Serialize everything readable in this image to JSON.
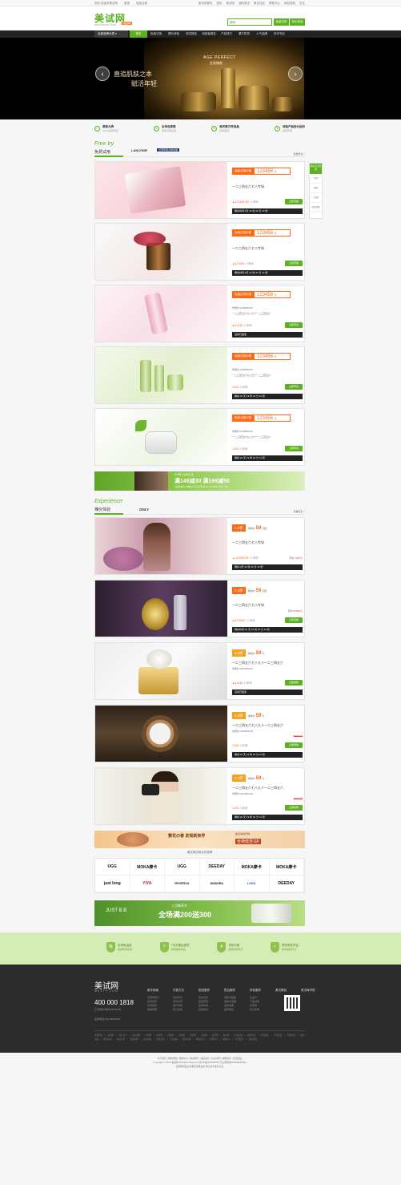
{
  "topbar": {
    "left": [
      "您好,欢迎来美试网",
      "登录",
      "免费注册"
    ],
    "right": [
      "美试网首页",
      "首页",
      "美试网",
      "我的美试",
      "美试社区",
      "帮助中心",
      "网站导航",
      "关注"
    ]
  },
  "header": {
    "logo": "美试网",
    "logo_sub": "WWW.MAXTP.COM",
    "logo_badge": "美试网",
    "search_placeholder": "搜索",
    "btn1": "免费试用",
    "btn2": "特价体验"
  },
  "nav": {
    "category": "全部品牌分类 ▾",
    "items": [
      "首页",
      "免费试用",
      "裸价体验",
      "测试报告",
      "消费者报告",
      "产品排行",
      "看牛机构",
      "人气品牌",
      "好评专区"
    ]
  },
  "banner": {
    "text1": "直追肌肤之本",
    "text2": "赋活年轻",
    "brand": "AGE PERFECT",
    "brand2": "金致臻颜",
    "prev": "‹",
    "next": "›"
  },
  "features": [
    {
      "icon": "✓",
      "title": "原装大牌",
      "sub": "100%品牌保证"
    },
    {
      "icon": "◎",
      "title": "全场包邮费",
      "sub": "免费试用全场"
    },
    {
      "icon": "★",
      "title": "每天数万件商品",
      "sub": "任你挑选"
    },
    {
      "icon": "¥",
      "title": "体验产品低价起折",
      "sub": "品牌优惠"
    }
  ],
  "free": {
    "en": "Free try",
    "cn": "免费试用",
    "brand_logo": "LANCÔME",
    "brand_tag": "兰蔻年度大牌试用",
    "more": "查看更多 >",
    "cards": [
      {
        "tag": "免费试用价格",
        "price": "123456",
        "unit": "件",
        "title": "一二三四五六七八专场",
        "count": "123456789",
        "count_unit": "人申请",
        "apply": "立即查看",
        "time": "剩余时间:0天 21 时 22 分 12 秒"
      },
      {
        "tag": "免费试用价格",
        "price": "123456",
        "unit": "件",
        "title": "一二三四五六七八专场",
        "count": "123456",
        "count_unit": "人申请",
        "apply": "立即查看",
        "time": "剩余时间:0天 21 时 22 分 12 秒"
      },
      {
        "tag": "免费试用价格",
        "price": "123456",
        "unit": "件",
        "meta1": "市场价:¥139999.00",
        "meta2": "一二三四五六七八九十一二三四五六",
        "count": "12345",
        "count_unit": "人申请",
        "apply": "立即申请",
        "time": "活动已结束"
      },
      {
        "tag": "免费试用价格",
        "price": "123456",
        "unit": "件",
        "meta1": "市场价:¥139999.00",
        "meta2": "一二三四五六七八九十一二三四五六",
        "count": "1234",
        "count_unit": "人申请",
        "apply": "立即申请",
        "time": "剩余:01 天 21 时 22 分 12 秒"
      },
      {
        "tag": "免费试用价格",
        "price": "123456",
        "unit": "件",
        "meta1": "市场价:¥139999.00",
        "meta2": "一二三四五六七八九十一二三四五六",
        "count": "1236",
        "count_unit": "人申请",
        "apply": "立即申请",
        "time": "剩余:01 天 21 时 22 分 12 秒"
      }
    ],
    "ad": {
      "brand": "PURELAND 诗",
      "text": "满149减30 满199减50",
      "sub": "天猫商城官方旗舰店 即日起至3月31日 IPHONE 吉价 已售"
    }
  },
  "exp": {
    "en": "Experience",
    "cn": "裸价体验",
    "brand_logo": "ONLY",
    "more": "查看更多 >",
    "cards": [
      {
        "disc": "2.2折",
        "price": "59",
        "unit": "元起",
        "title": "一二三四五六七八专场",
        "count": "123456789",
        "count_unit": "人申请",
        "orig_label": "原价:",
        "orig": "1000元",
        "apply": "立即查看",
        "time": "剩余:0天 21 时 22 分 12 秒"
      },
      {
        "disc": "2.2折",
        "price": "59",
        "unit": "元起",
        "title": "一二三四五六七八专场",
        "count": "1234567",
        "count_unit": "人申请",
        "orig_label": "原价:",
        "orig": "99999元",
        "apply": "立即查看",
        "time": "剩余时间:01 天 21 时 22 分 12 秒"
      },
      {
        "disc": "2.2折",
        "price": "59",
        "unit": "元",
        "title": "一二三四五六七八九十一二三四五六",
        "meta1": "市场价:¥123456.00",
        "count": "12345",
        "count_unit": "人申请",
        "apply": "立即抢购",
        "time": "活动已结束"
      },
      {
        "disc": "2.2折",
        "price": "59",
        "unit": "元",
        "title": "一二三四五六七八九十一二三四五六",
        "meta1": "市场价:¥123456.00",
        "orig": "99999元",
        "count": "1238",
        "count_unit": "人申请",
        "apply": "立即抢购",
        "time": "剩余:01 天 21 时 22 分 12 秒"
      },
      {
        "disc": "2.2折",
        "price": "59",
        "unit": "元",
        "title": "一二三四五六七八九十一二三四五六",
        "meta1": "市场价:¥123456.00",
        "orig": "99999元",
        "count": "1238",
        "count_unit": "人申请",
        "apply": "立即抢购",
        "time": "剩余:01 天 21 时 22 分 12 秒"
      }
    ],
    "ad": {
      "text": "繁花の春 发现新饰界",
      "sub": "全场低至1折",
      "sub2": "甄选新品欢乐购"
    }
  },
  "brands": {
    "title": "美试网目前合作品牌",
    "items": [
      "UGG",
      "MOKA摩卡",
      "UGG",
      "DEEDAY",
      "MOKA摩卡",
      "MOKA摩卡",
      "just long",
      "YIYA",
      "SPORTICA",
      "DIADORA",
      "LOGO",
      "DEEDAY"
    ]
  },
  "bottom_ad": {
    "brand": "JUST B.B",
    "title": "三月畅享节",
    "text": "全场满200送300"
  },
  "service": [
    {
      "icon": "免",
      "title": "全场免运费",
      "sub": "免邮费用全场"
    },
    {
      "icon": "7",
      "title": "7天无理由退货",
      "sub": "如何退换商品"
    },
    {
      "icon": "¥",
      "title": "货到付款",
      "sub": "如何选择支付"
    },
    {
      "icon": "✓",
      "title": "提供有效凭证",
      "sub": "如何提供凭证"
    }
  ],
  "footer": {
    "logo": "美试网",
    "logo_sub": "MAXTP.COM",
    "phone": "400 000 1818",
    "hours": "工作时间:每天9:00-18:00",
    "email": "招商电话:010-66666666",
    "cols": [
      {
        "h": "新手指南",
        "items": [
          "注册新用户",
          "会员登录",
          "找回密码",
          "购物流程"
        ]
      },
      {
        "h": "付款方式",
        "items": [
          "在线支付",
          "货到付款",
          "银行转账",
          "积分兑换"
        ]
      },
      {
        "h": "配送服务",
        "items": [
          "配送方式",
          "配送范围",
          "配送时间",
          "签收验货"
        ]
      },
      {
        "h": "售后服务",
        "items": [
          "退换货政策",
          "退换货流程",
          "退款说明",
          "返修服务"
        ]
      },
      {
        "h": "特色服务",
        "items": [
          "礼品卡",
          "产品试用",
          "优惠券",
          "积分商城"
        ]
      },
      {
        "h": "美试微信",
        "items": [
          "扫一扫",
          "关注我们",
          "",
          ""
        ]
      },
      {
        "h": "美试商学院",
        "items": [
          " ",
          " ",
          " ",
          " "
        ]
      }
    ],
    "links": "友情链接 | 美试网 | 美妆达人 | 化妆品网 | 时尚网 | 美容网 | 护肤网 | 彩妆网 | 香水网 | 美发网 | 美甲网 | 瘦身网 | 时尚女装 | 品牌男装 | 鞋类箱包 | 手表饰品 | 母婴用品 | 家居用品 | 数码家电 | 运动户外 | 食品保健 | 美食团购 | 旅游度假 | 汽车用品 | 图书音像 | 网络游戏 | 手机通讯 | 电脑办公 | 生活服务 | 更多链接"
  },
  "copyright": {
    "line1": "关于我们 | 网站导航 | 帮助中心 | 联系我们 | 诚征英才 | 免责声明 | 诚聘英才 | 意见反馈",
    "line2": "Copyright © 2013 美试网 All Rights Reserved 京ICP备00000000号 京公网安备000000000000",
    "line3": "互联网药品信息服务资格证书 电子商务诚信认证"
  },
  "float": {
    "top": "领取 美试优惠",
    "items": [
      "签到",
      "客服",
      "二维码",
      "返回顶部"
    ]
  }
}
